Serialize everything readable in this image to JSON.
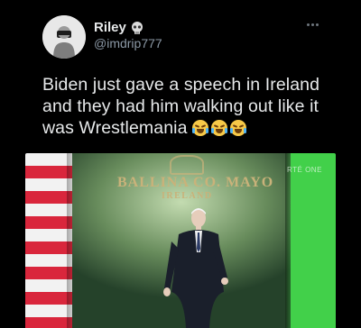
{
  "author": {
    "name": "Riley",
    "handle": "@imdrip777"
  },
  "tweet": {
    "text": "Biden just gave a speech in Ireland and they had him walking out like it was Wrestlemania",
    "emojis": [
      "loudly-crying-face",
      "loudly-crying-face",
      "loudly-crying-face"
    ]
  },
  "media": {
    "sign_line1": "BALLINA CO. MAYO",
    "sign_line2": "IRELAND",
    "watermark": "RTÉ ONE"
  },
  "colors": {
    "background": "#000000",
    "text": "#e7e9ea",
    "secondary_text": "#8b98a5"
  }
}
